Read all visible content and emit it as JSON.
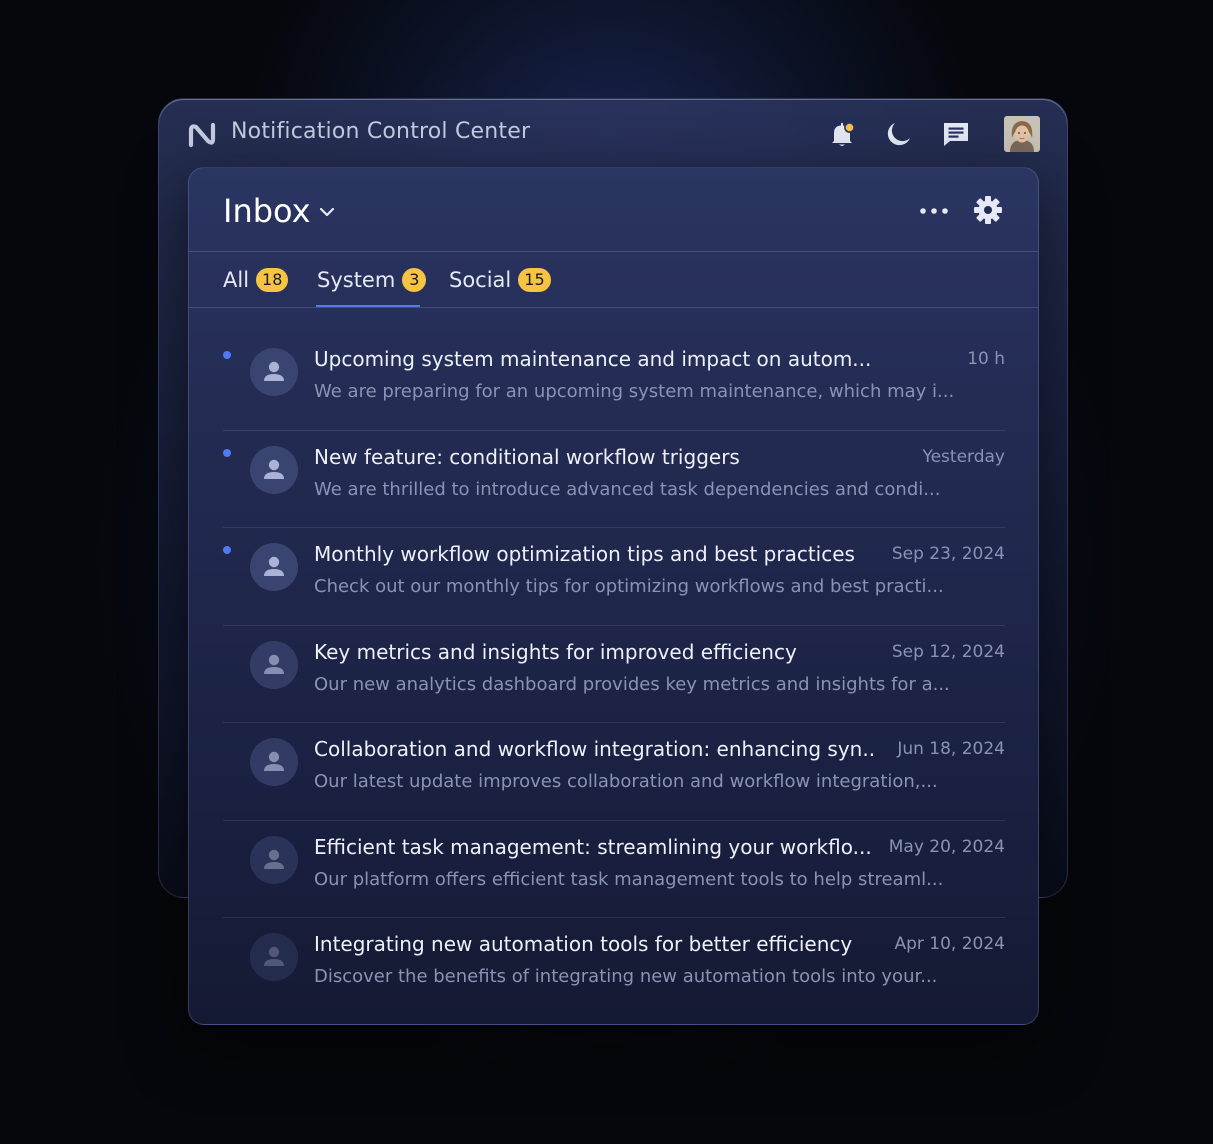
{
  "app": {
    "title": "Notification Control Center",
    "icons": [
      "logo-icon",
      "bell-icon",
      "moon-icon",
      "message-icon"
    ]
  },
  "inbox": {
    "title": "Inbox",
    "icons": [
      "chevron-down-icon",
      "more-icon",
      "gear-icon"
    ]
  },
  "tabs": [
    {
      "label": "All",
      "count": "18"
    },
    {
      "label": "System",
      "count": "3",
      "selected": true
    },
    {
      "label": "Social",
      "count": "15"
    }
  ],
  "colors": {
    "accent": "#4f7bf0",
    "badge": "#f5c443",
    "panel": "#232b52"
  },
  "notifications": [
    {
      "title": "Upcoming system maintenance and impact on autom...",
      "time": "10 h",
      "preview": "We are preparing for an upcoming system maintenance, which may i...",
      "unread": true
    },
    {
      "title": "New feature: conditional workflow triggers",
      "time": "Yesterday",
      "preview": "We are thrilled to introduce advanced task dependencies and condi...",
      "unread": true
    },
    {
      "title": "Monthly workflow optimization tips and best practices",
      "time": "Sep 23, 2024",
      "preview": "Check out our monthly tips for optimizing workflows and best practi...",
      "unread": true
    },
    {
      "title": "Key metrics and insights for improved efficiency",
      "time": "Sep 12, 2024",
      "preview": "Our new analytics dashboard provides key metrics and insights for a...",
      "unread": false
    },
    {
      "title": "Collaboration and workflow integration: enhancing syn...",
      "time": "Jun 18, 2024",
      "preview": "Our latest update improves collaboration and workflow integration,...",
      "unread": false
    },
    {
      "title": "Efficient task management: streamlining your workflo...",
      "time": "May 20, 2024",
      "preview": "Our platform offers efficient task management tools to help streaml...",
      "unread": false
    },
    {
      "title": "Integrating new automation tools for better efficiency",
      "time": "Apr 10, 2024",
      "preview": "Discover the benefits of integrating new automation tools into your...",
      "unread": false
    }
  ]
}
